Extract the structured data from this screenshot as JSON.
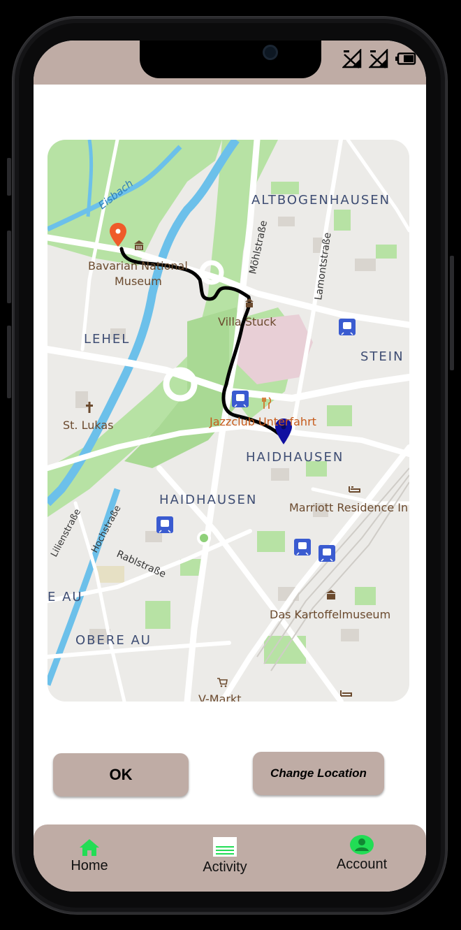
{
  "colors": {
    "accent_bar": "#bfaca5",
    "nav_icon_active": "#22dd55",
    "origin_pin": "#ef5b2a",
    "destination_pin": "#1010a0",
    "route_line": "#000000"
  },
  "status_bar": {
    "icons": [
      "signal-1-icon",
      "signal-2-icon",
      "battery-icon"
    ]
  },
  "map": {
    "labels": {
      "eisbach": "Eisbach",
      "altbogenhausen": "ALTBOGENHAUSEN",
      "mohlstrasse": "Möhlstraße",
      "lamontstrasse": "Lamontstraße",
      "bavarian_museum_line1": "Bavarian National",
      "bavarian_museum_line2": "Museum",
      "villa_stuck": "Villa Stuck",
      "lehel": "LEHEL",
      "stein": "STEIN",
      "st_lukas": "St. Lukas",
      "jazzclub": "Jazzclub Unterfahrt",
      "haidhausen_east": "HAIDHAUSEN",
      "haidhausen_west": "HAIDHAUSEN",
      "marriott": "Marriott Residence In",
      "lilienstrasse": "Lilienstraße",
      "hochstrasse": "Hochstraße",
      "rablstrasse": "Rablstraße",
      "e_au": "E AU",
      "kartoffelmuseum": "Das Kartoffelmuseum",
      "obere_au": "OBERE AU",
      "v_markt": "V-Markt"
    }
  },
  "buttons": {
    "ok": "OK",
    "change_location": "Change Location"
  },
  "nav": {
    "home": {
      "label": "Home",
      "icon": "home-icon"
    },
    "activity": {
      "label": "Activity",
      "icon": "list-icon"
    },
    "account": {
      "label": "Account",
      "icon": "user-icon"
    }
  }
}
